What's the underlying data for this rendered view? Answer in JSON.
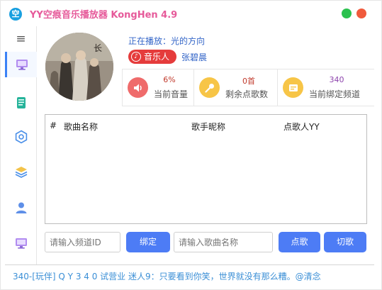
{
  "app": {
    "title": "YY空痕音乐播放器 KongHen 4.9",
    "logo_glyph": "空"
  },
  "sidebar": {
    "items": [
      {
        "icon": "menu-icon"
      },
      {
        "icon": "monitor-icon",
        "active": true
      },
      {
        "icon": "book-icon"
      },
      {
        "icon": "settings-icon"
      },
      {
        "icon": "layers-icon"
      },
      {
        "icon": "user-icon"
      },
      {
        "icon": "screen-icon"
      }
    ]
  },
  "now_playing": {
    "text": "正在播放：光的方向",
    "singer_label": "音乐人",
    "singer_name": "张碧晨"
  },
  "stats": [
    {
      "value": "6%",
      "label": "当前音量",
      "icon": "volume-icon",
      "color": "#ef6b6b",
      "value_color": "#c0392b"
    },
    {
      "value": "0首",
      "label": "剩余点歌数",
      "icon": "microphone-icon",
      "color": "#f7c547",
      "value_color": "#c0392b"
    },
    {
      "value": "340",
      "label": "当前绑定频道",
      "icon": "channel-icon",
      "color": "#f7c547",
      "value_color": "#8e44ad"
    }
  ],
  "table": {
    "columns": [
      "#",
      "歌曲名称",
      "歌手昵称",
      "点歌人YY"
    ],
    "rows": []
  },
  "controls": {
    "channel_placeholder": "请输入频道ID",
    "bind_label": "绑定",
    "song_placeholder": "请输入歌曲名称",
    "request_label": "点歌",
    "switch_label": "切歌"
  },
  "status": {
    "text": "340-[玩伴] Q Y 3 4 0  试营业  迷人9：只要看到你笑，世界就没有那么糟。@清念"
  },
  "colors": {
    "accent": "#4d7cf5",
    "title": "#e65a9a",
    "link": "#3466c8"
  }
}
